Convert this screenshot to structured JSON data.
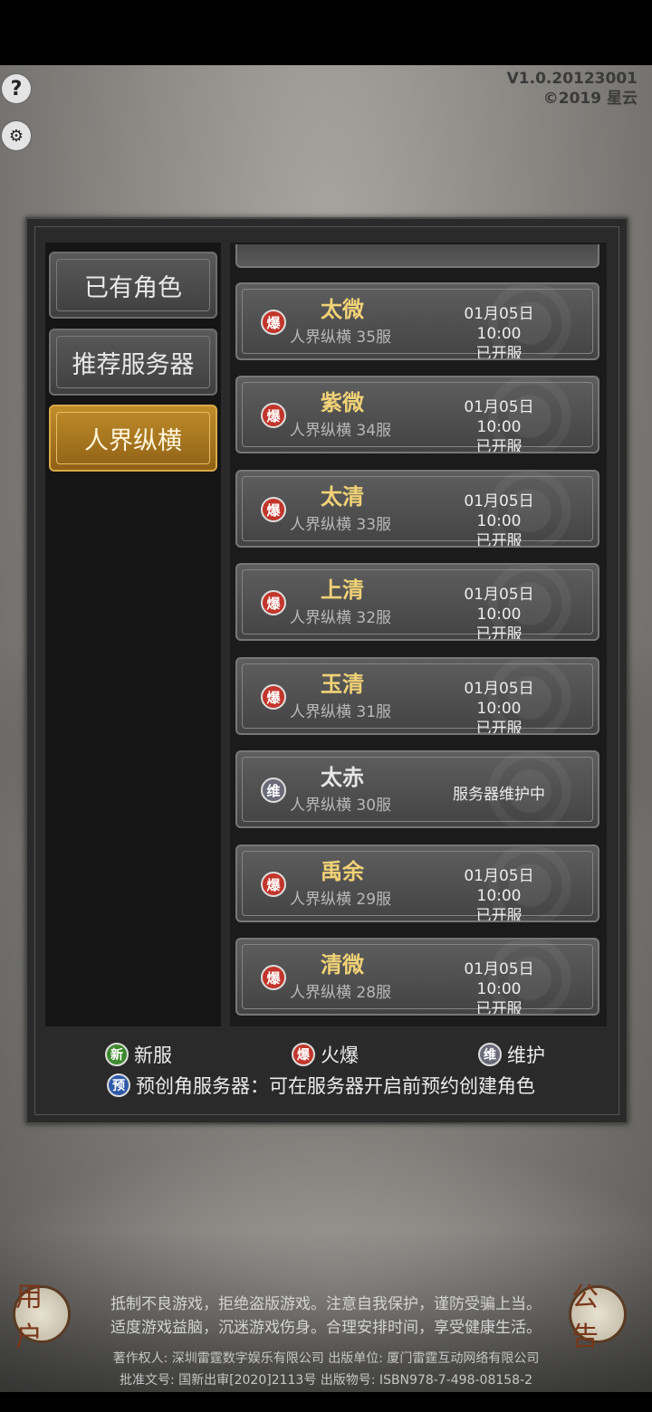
{
  "header": {
    "help_icon": "question-mark-icon",
    "settings_icon": "wrench-icon",
    "version_line1": "V1.0.20123001",
    "version_line2": "©2019 星云"
  },
  "tabs": [
    {
      "label": "已有角色",
      "active": false
    },
    {
      "label": "推荐服务器",
      "active": false
    },
    {
      "label": "人界纵横",
      "active": true
    }
  ],
  "servers": [
    {
      "badge": "爆",
      "type": "hot",
      "name": "太微",
      "group": "人界纵横 35服",
      "date": "01月05日 10:00",
      "status": "已开服"
    },
    {
      "badge": "爆",
      "type": "hot",
      "name": "紫微",
      "group": "人界纵横 34服",
      "date": "01月05日 10:00",
      "status": "已开服"
    },
    {
      "badge": "爆",
      "type": "hot",
      "name": "太清",
      "group": "人界纵横 33服",
      "date": "01月05日 10:00",
      "status": "已开服"
    },
    {
      "badge": "爆",
      "type": "hot",
      "name": "上清",
      "group": "人界纵横 32服",
      "date": "01月05日 10:00",
      "status": "已开服"
    },
    {
      "badge": "爆",
      "type": "hot",
      "name": "玉清",
      "group": "人界纵横 31服",
      "date": "01月05日 10:00",
      "status": "已开服"
    },
    {
      "badge": "维",
      "type": "maint",
      "name": "太赤",
      "group": "人界纵横 30服",
      "date": "",
      "status": "服务器维护中"
    },
    {
      "badge": "爆",
      "type": "hot",
      "name": "禹余",
      "group": "人界纵横 29服",
      "date": "01月05日 10:00",
      "status": "已开服"
    },
    {
      "badge": "爆",
      "type": "hot",
      "name": "清微",
      "group": "人界纵横 28服",
      "date": "01月05日 10:00",
      "status": "已开服"
    }
  ],
  "legend": {
    "new_badge": "新",
    "new_label": "新服",
    "hot_badge": "爆",
    "hot_label": "火爆",
    "maint_badge": "维",
    "maint_label": "维护",
    "pre_badge": "预",
    "pre_note": "预创角服务器：可在服务器开启前预约创建角色"
  },
  "colors": {
    "new": "#3d8a2e",
    "hot": "#c2352a",
    "maint": "#6a6a7a",
    "pre": "#2e5aa8",
    "server_name": "#f1d276",
    "active_tab": "#b07f22"
  },
  "bottom": {
    "user_button": "用户",
    "notice_button": "公告",
    "disclaimer_line1": "抵制不良游戏，拒绝盗版游戏。注意自我保护，谨防受骗上当。",
    "disclaimer_line2": "适度游戏益脑，沉迷游戏伤身。合理安排时间，享受健康生活。",
    "copyright_line1": "著作权人: 深圳雷霆数字娱乐有限公司 出版单位: 厦门雷霆互动网络有限公司",
    "copyright_line2": "批准文号: 国新出审[2020]2113号 出版物号: ISBN978-7-498-08158-2"
  }
}
